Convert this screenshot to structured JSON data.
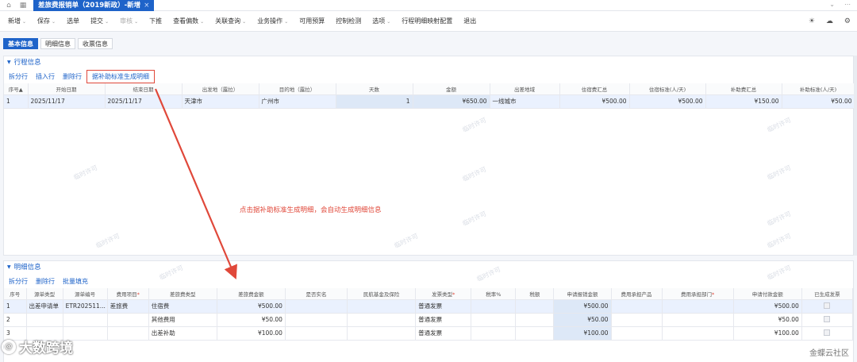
{
  "topbar": {
    "tab_title": "差旅费报销单（2019新政）-新增",
    "tab_close": "×"
  },
  "toolbar": {
    "items": [
      {
        "label": "新增",
        "dd": true,
        "disabled": false
      },
      {
        "label": "保存",
        "dd": true,
        "disabled": false
      },
      {
        "label": "选单",
        "dd": false,
        "disabled": false
      },
      {
        "label": "提交",
        "dd": true,
        "disabled": false
      },
      {
        "label": "审核",
        "dd": true,
        "disabled": true
      },
      {
        "label": "下推",
        "dd": false,
        "disabled": false
      },
      {
        "label": "查看偏数",
        "dd": true,
        "disabled": false
      },
      {
        "label": "关联查询",
        "dd": true,
        "disabled": false
      },
      {
        "label": "业务操作",
        "dd": true,
        "disabled": false
      },
      {
        "label": "可用预算",
        "dd": false,
        "disabled": false
      },
      {
        "label": "控制检测",
        "dd": false,
        "disabled": false
      },
      {
        "label": "选项",
        "dd": true,
        "disabled": false
      },
      {
        "label": "行程明细映射配置",
        "dd": false,
        "disabled": false
      },
      {
        "label": "退出",
        "dd": false,
        "disabled": false
      }
    ]
  },
  "subtabs": [
    "基本信息",
    "明细信息",
    "收票信息"
  ],
  "trip": {
    "title": "行程信息",
    "actions": [
      "拆分行",
      "插入行",
      "删除行"
    ],
    "highlight_action": "据补助标准生成明细",
    "columns": [
      "序号▲",
      "开始日期",
      "结束日期",
      "出发地（露拉）",
      "目的地（露拉）",
      "天数",
      "金额",
      "出差地域",
      "住宿费汇总",
      "住宿标准(人/天)",
      "补助费汇总",
      "补助标准(人/天)"
    ],
    "rows": [
      [
        "1",
        "2025/11/17",
        "2025/11/17",
        "天津市",
        "广州市",
        "1",
        "¥650.00",
        "一线城市",
        "¥500.00",
        "¥500.00",
        "¥150.00",
        "¥50.00"
      ]
    ]
  },
  "callout": "点击据补助标准生成明细，会自动生成明细信息",
  "detail": {
    "title": "明细信息",
    "actions": [
      "拆分行",
      "删除行",
      "批量填充"
    ],
    "columns": [
      {
        "label": "序号",
        "req": false
      },
      {
        "label": "源单类型",
        "req": false
      },
      {
        "label": "源单编号",
        "req": false
      },
      {
        "label": "费用项目",
        "req": true
      },
      {
        "label": "差旅费类型",
        "req": false
      },
      {
        "label": "差旅费金额",
        "req": false
      },
      {
        "label": "是否实名",
        "req": false
      },
      {
        "label": "民航基金及保险",
        "req": false
      },
      {
        "label": "发票类型",
        "req": true
      },
      {
        "label": "税率%",
        "req": false
      },
      {
        "label": "税额",
        "req": false
      },
      {
        "label": "申请报销金额",
        "req": false
      },
      {
        "label": "费用承担产品",
        "req": false
      },
      {
        "label": "费用承担部门",
        "req": true
      },
      {
        "label": "申请付款金额",
        "req": false
      },
      {
        "label": "已生成发票",
        "req": false
      }
    ],
    "rows": [
      [
        "1",
        "出差申请单",
        "ETR202511...",
        "差旅费",
        "住宿费",
        "¥500.00",
        "",
        "",
        "普通发票",
        "",
        "",
        "¥500.00",
        "",
        "",
        "¥500.00",
        ""
      ],
      [
        "2",
        "",
        "",
        "",
        "其他费用",
        "¥50.00",
        "",
        "",
        "普通发票",
        "",
        "",
        "¥50.00",
        "",
        "",
        "¥50.00",
        ""
      ],
      [
        "3",
        "",
        "",
        "",
        "出差补助",
        "¥100.00",
        "",
        "",
        "普通发票",
        "",
        "",
        "¥100.00",
        "",
        "",
        "¥100.00",
        ""
      ]
    ]
  },
  "watermark": "临时许可",
  "logo_text": "大数跨境",
  "brand_text": "金蝶云社区",
  "colors": {
    "accent": "#1e63c9",
    "highlight_red": "#e0483a",
    "row_selected": "#eaf1fe"
  }
}
